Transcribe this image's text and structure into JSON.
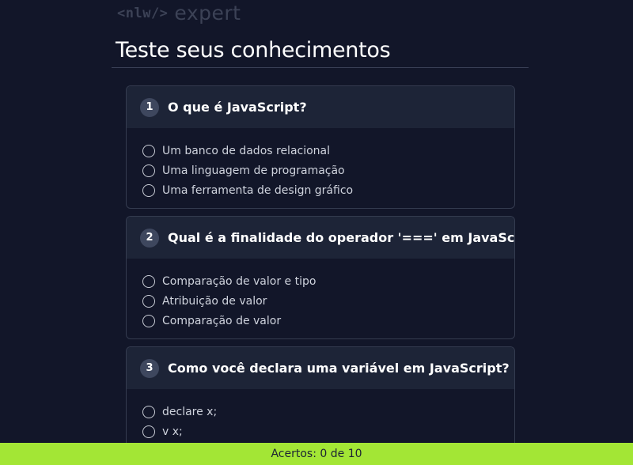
{
  "logo": {
    "code": "<nlw/>",
    "word": "expert"
  },
  "page": {
    "title": "Teste seus conhecimentos"
  },
  "questions": [
    {
      "number": "1",
      "text": "O que é JavaScript?",
      "options": [
        "Um banco de dados relacional",
        "Uma linguagem de programação",
        "Uma ferramenta de design gráfico"
      ]
    },
    {
      "number": "2",
      "text": "Qual é a finalidade do operador '===' em JavaScript?",
      "options": [
        "Comparação de valor e tipo",
        "Atribuição de valor",
        "Comparação de valor"
      ]
    },
    {
      "number": "3",
      "text": "Como você declara uma variável em JavaScript?",
      "options": [
        "declare x;",
        "v x;"
      ]
    }
  ],
  "footer": {
    "score": "Acertos: 0 de 10"
  },
  "colors": {
    "accent": "#a3e635",
    "background": "#121629",
    "card_header": "#1d2437"
  }
}
